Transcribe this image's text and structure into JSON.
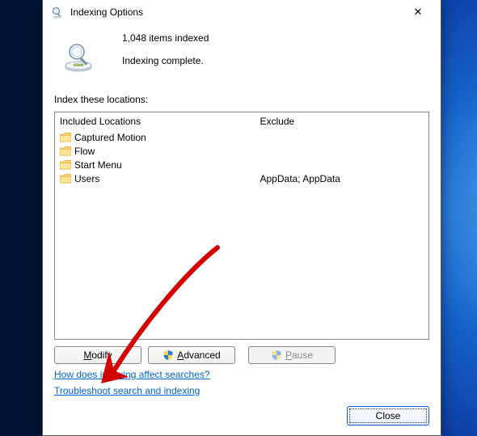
{
  "window": {
    "title": "Indexing Options",
    "close_glyph": "✕"
  },
  "status": {
    "count_line": "1,048 items indexed",
    "state_line": "Indexing complete."
  },
  "section_label": "Index these locations:",
  "columns": {
    "included": "Included Locations",
    "exclude": "Exclude"
  },
  "locations": [
    {
      "name": "Captured Motion",
      "exclude": ""
    },
    {
      "name": "Flow",
      "exclude": ""
    },
    {
      "name": "Start Menu",
      "exclude": ""
    },
    {
      "name": "Users",
      "exclude": "AppData; AppData"
    }
  ],
  "buttons": {
    "modify_pre": "",
    "modify_u": "M",
    "modify_post": "odify",
    "advanced_pre": "",
    "advanced_u": "A",
    "advanced_post": "dvanced",
    "pause_pre": "",
    "pause_u": "P",
    "pause_post": "ause",
    "close": "Close"
  },
  "links": {
    "help": "How does indexing affect searches?",
    "troubleshoot": "Troubleshoot search and indexing"
  }
}
